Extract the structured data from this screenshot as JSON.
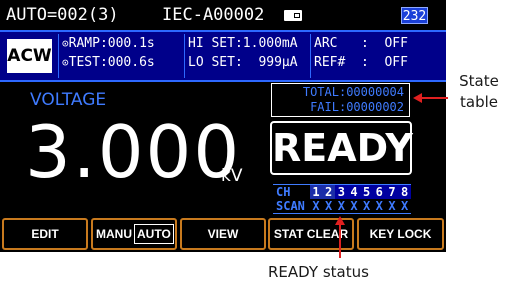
{
  "topbar": {
    "mode": "AUTO=002(3)",
    "standard": "IEC-A00002",
    "usb_icon": "usb-icon",
    "interface_id": "232"
  },
  "params": {
    "function": "ACW",
    "ramp_label": "RAMP",
    "ramp_value": ":000.1s",
    "test_label": "TEST",
    "test_value": ":000.6s",
    "hi_set": "HI SET:1.000mA",
    "lo_set": "LO SET:  999μA",
    "arc": "ARC   :  OFF",
    "ref": "REF#  :  OFF"
  },
  "display": {
    "label": "VOLTAGE",
    "value": "3.000",
    "unit": "kV",
    "total": "TOTAL:00000004",
    "fail": "FAIL:00000002",
    "status": "READY"
  },
  "scan": {
    "ch_label": "CH",
    "scan_label": "SCAN",
    "channels": [
      "1",
      "2",
      "3",
      "4",
      "5",
      "6",
      "7",
      "8"
    ],
    "states": [
      "X",
      "X",
      "X",
      "X",
      "X",
      "X",
      "X",
      "X"
    ]
  },
  "softkeys": {
    "edit": "EDIT",
    "manu": "MANU",
    "auto": "AUTO",
    "view": "VIEW",
    "stat_clear": "STAT CLEAR",
    "key_lock": "KEY LOCK"
  },
  "annotations": {
    "state_line1": "State",
    "state_line2": "table",
    "ready": "READY status"
  },
  "colors": {
    "accent_blue": "#3f7bff",
    "panel_blue": "#00008a",
    "softkey_border": "#c87a1e",
    "annotation_arrow": "#e02020"
  }
}
